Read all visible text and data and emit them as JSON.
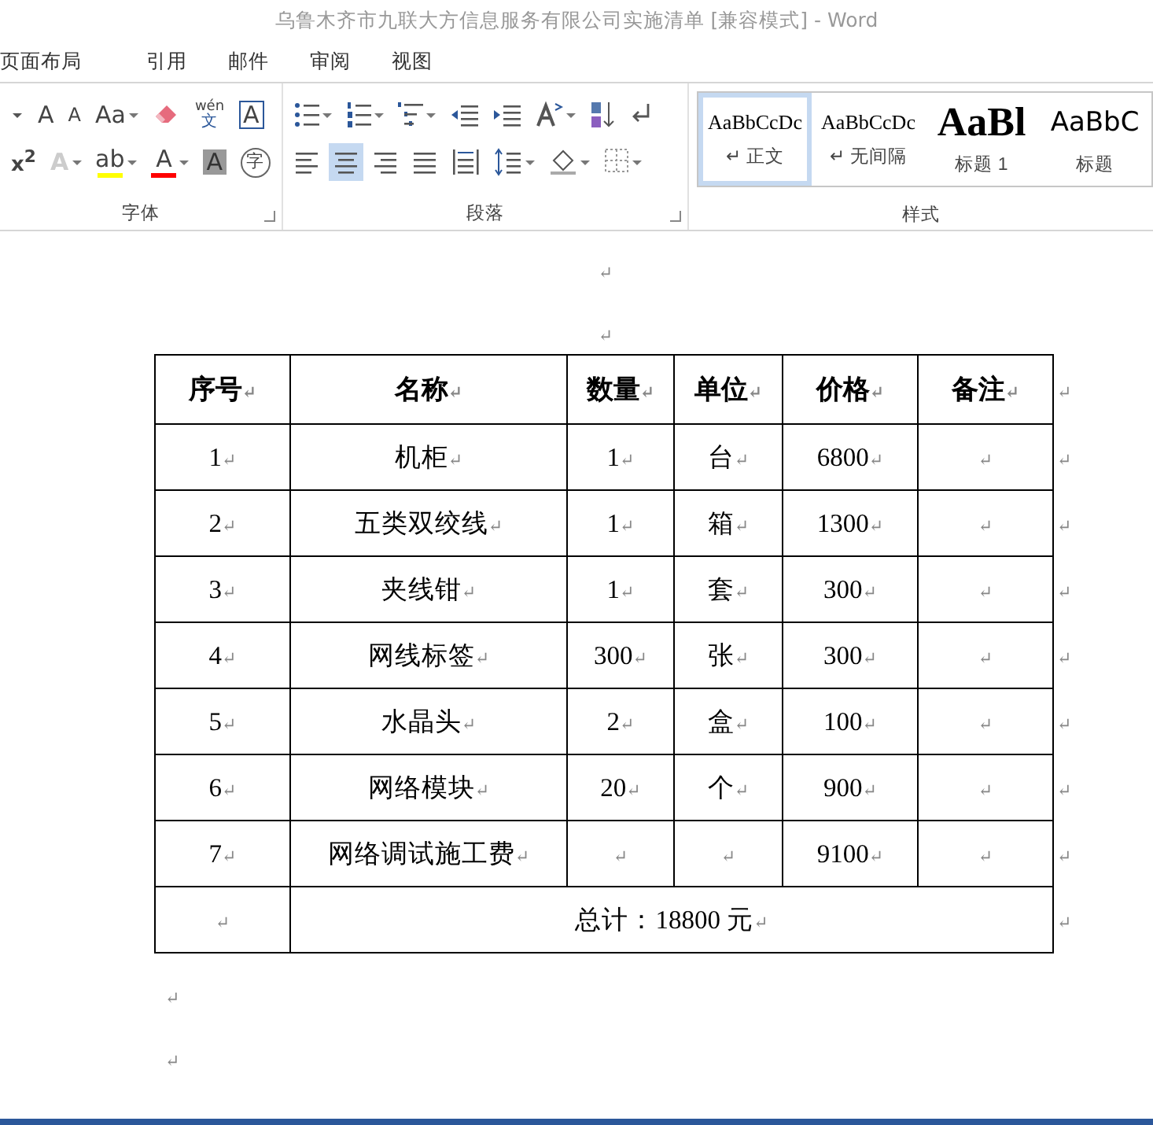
{
  "window": {
    "title": "乌鲁木齐市九联大方信息服务有限公司实施清单 [兼容模式] - Word"
  },
  "tabs": [
    {
      "label": "页面布局",
      "selected": false
    },
    {
      "label": "引用",
      "selected": false
    },
    {
      "label": "邮件",
      "selected": false
    },
    {
      "label": "审阅",
      "selected": false
    },
    {
      "label": "视图",
      "selected": false
    }
  ],
  "ribbon": {
    "font_group": {
      "label": "字体",
      "top_row": [
        {
          "kind": "icon"
        },
        {
          "kind": "glyph",
          "glyph": "A"
        },
        {
          "kind": "glyph",
          "glyph": "A"
        },
        {
          "kind": "glyph",
          "glyph": "Aa"
        },
        {
          "kind": "icon"
        },
        {
          "kind": "glyph",
          "glyph": "wén",
          "sub": "文"
        },
        {
          "kind": "glyph",
          "glyph": "A"
        }
      ],
      "bottom_row": [
        {
          "kind": "glyph",
          "glyph": "x$^{2}$"
        },
        {
          "kind": "glyph",
          "glyph": "A",
          "disabled": true
        },
        {
          "kind": "glyph",
          "glyph": "ab",
          "color": "#ffff00"
        },
        {
          "kind": "glyph",
          "glyph": "A",
          "color": "#ff0000"
        },
        {
          "kind": "glyph",
          "glyph": "A"
        },
        {
          "kind": "glyph",
          "glyph": "字"
        }
      ]
    },
    "paragraph_group": {
      "label": "段落",
      "top_row": [
        {
          "kind": "icon"
        },
        {
          "kind": "icon"
        },
        {
          "kind": "icon"
        },
        {
          "kind": "icon"
        },
        {
          "kind": "icon"
        },
        {
          "kind": "icon"
        },
        {
          "kind": "icon"
        },
        {
          "kind": "icon"
        }
      ],
      "bottom_row": [
        {
          "kind": "icon",
          "selected": false
        },
        {
          "kind": "icon",
          "selected": true
        },
        {
          "kind": "icon",
          "selected": false
        },
        {
          "kind": "icon",
          "selected": false
        },
        {
          "kind": "icon",
          "selected": false
        },
        {
          "kind": "icon"
        },
        {
          "kind": "icon"
        },
        {
          "kind": "icon"
        }
      ]
    },
    "styles_group": {
      "label": "样式",
      "styles": [
        {
          "preview": "AaBbCcDc",
          "name": "↵ 正文",
          "kind": "normal",
          "selected": true
        },
        {
          "preview": "AaBbCcDc",
          "name": "↵ 无间隔",
          "kind": "normal",
          "selected": false
        },
        {
          "preview": "AaBl",
          "name": "标题 1",
          "kind": "heading1",
          "selected": false
        },
        {
          "preview": "AaBbC",
          "name": "标题",
          "kind": "title",
          "selected": false
        }
      ]
    }
  },
  "document": {
    "marks_before": [
      "↵",
      "↵"
    ],
    "table": {
      "columns": [
        {
          "text": "序号",
          "mark": "↵"
        },
        {
          "text": "名称",
          "mark": "↵"
        },
        {
          "text": "数量",
          "mark": "↵"
        },
        {
          "text": "单位",
          "mark": "↵"
        },
        {
          "text": "价格",
          "mark": "↵"
        },
        {
          "text": "备注",
          "mark": "↵"
        }
      ],
      "header_end_mark": "↵",
      "rows": [
        {
          "cells": [
            {
              "text": "1",
              "mark": "↵"
            },
            {
              "text": "机柜",
              "mark": "↵"
            },
            {
              "text": "1",
              "mark": "↵"
            },
            {
              "text": "台",
              "mark": "↵"
            },
            {
              "text": "6800",
              "mark": "↵"
            },
            {
              "mark": "↵"
            }
          ],
          "end_mark": "↵"
        },
        {
          "cells": [
            {
              "text": "2",
              "mark": "↵"
            },
            {
              "text": "五类双绞线",
              "mark": "↵"
            },
            {
              "text": "1",
              "mark": "↵"
            },
            {
              "text": "箱",
              "mark": "↵"
            },
            {
              "text": "1300",
              "mark": "↵"
            },
            {
              "mark": "↵"
            }
          ],
          "end_mark": "↵"
        },
        {
          "cells": [
            {
              "text": "3",
              "mark": "↵"
            },
            {
              "text": "夹线钳",
              "mark": "↵"
            },
            {
              "text": "1",
              "mark": "↵"
            },
            {
              "text": "套",
              "mark": "↵"
            },
            {
              "text": "300",
              "mark": "↵"
            },
            {
              "mark": "↵"
            }
          ],
          "end_mark": "↵"
        },
        {
          "cells": [
            {
              "text": "4",
              "mark": "↵"
            },
            {
              "text": "网线标签",
              "mark": "↵"
            },
            {
              "text": "300",
              "mark": "↵"
            },
            {
              "text": "张",
              "mark": "↵"
            },
            {
              "text": "300",
              "mark": "↵"
            },
            {
              "mark": "↵"
            }
          ],
          "end_mark": "↵"
        },
        {
          "cells": [
            {
              "text": "5",
              "mark": "↵"
            },
            {
              "text": "水晶头",
              "mark": "↵"
            },
            {
              "text": "2",
              "mark": "↵"
            },
            {
              "text": "盒",
              "mark": "↵"
            },
            {
              "text": "100",
              "mark": "↵"
            },
            {
              "mark": "↵"
            }
          ],
          "end_mark": "↵"
        },
        {
          "cells": [
            {
              "text": "6",
              "mark": "↵"
            },
            {
              "text": "网络模块",
              "mark": "↵"
            },
            {
              "text": "20",
              "mark": "↵"
            },
            {
              "text": "个",
              "mark": "↵"
            },
            {
              "text": "900",
              "mark": "↵"
            },
            {
              "mark": "↵"
            }
          ],
          "end_mark": "↵"
        },
        {
          "cells": [
            {
              "text": "7",
              "mark": "↵"
            },
            {
              "text": "网络调试施工费",
              "mark": "↵"
            },
            {
              "mark": "↵"
            },
            {
              "mark": "↵"
            },
            {
              "text": "9100",
              "mark": "↵"
            },
            {
              "mark": "↵"
            }
          ],
          "end_mark": "↵"
        }
      ],
      "total_row": {
        "label_cell": {
          "mark": "↵"
        },
        "total": {
          "text": "总计：18800 元",
          "mark": "↵"
        },
        "end_mark": "↵"
      }
    },
    "marks_after": [
      "↵",
      "↵"
    ]
  }
}
